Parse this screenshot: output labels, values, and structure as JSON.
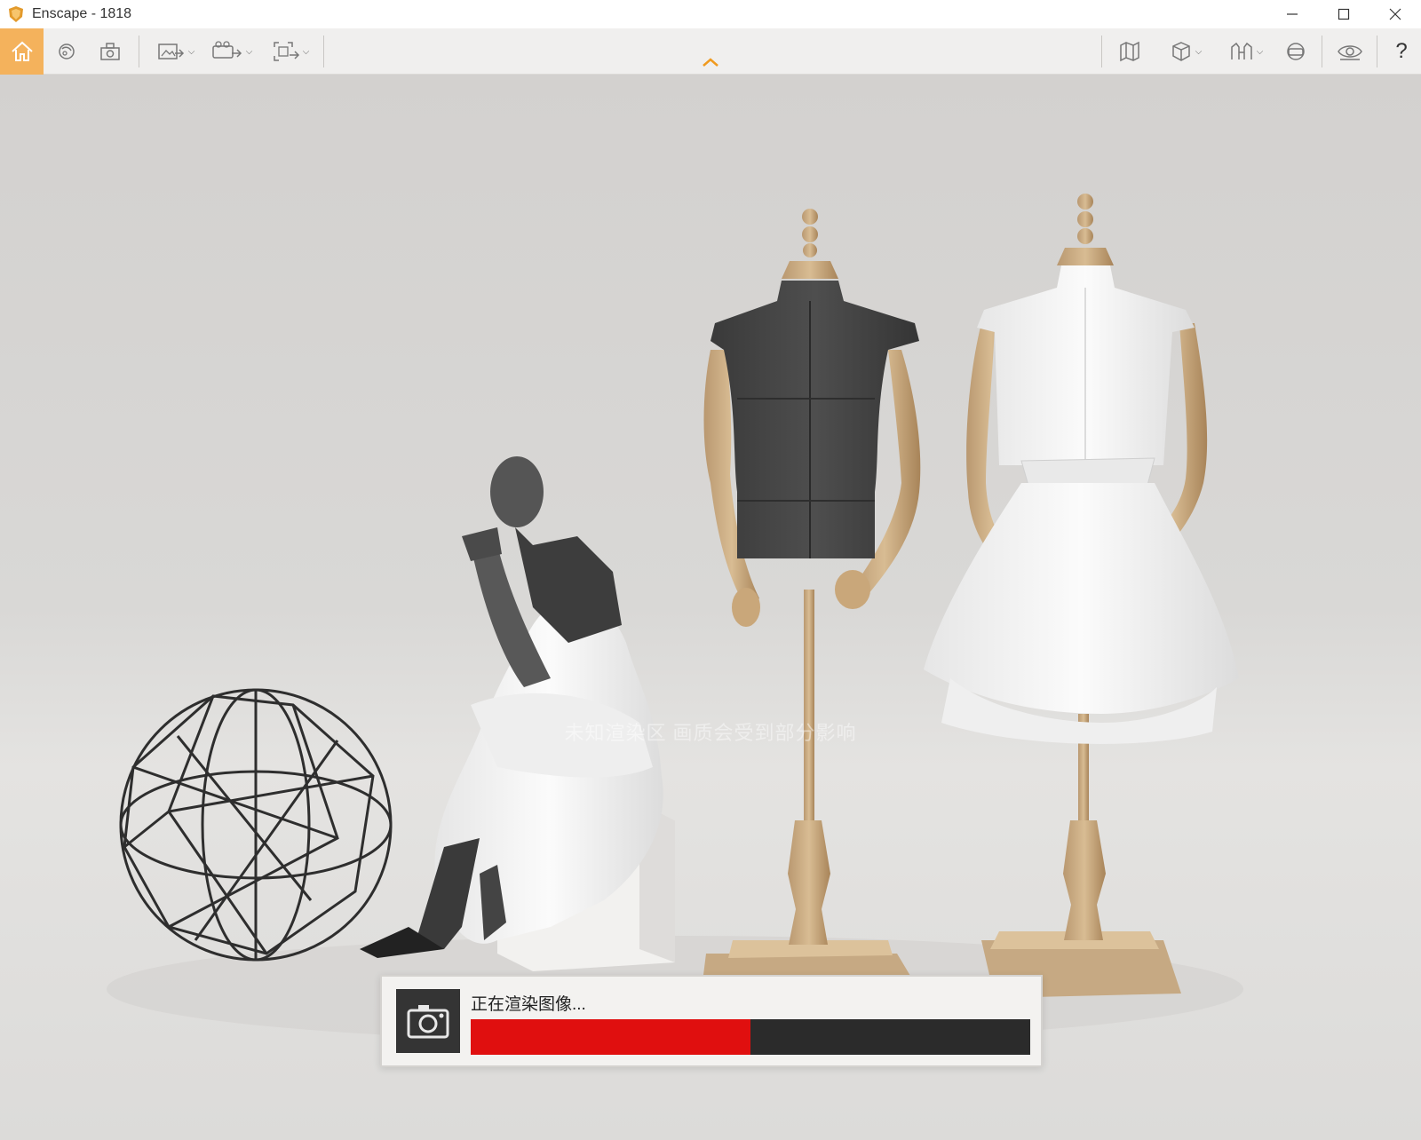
{
  "window": {
    "title": "Enscape - 1818"
  },
  "toolbar": {
    "left_icons": [
      "home-icon",
      "orbit-icon",
      "screenshot-icon",
      "export-image-icon",
      "export-video-icon",
      "capture-area-icon"
    ],
    "right_icons": [
      "map-icon",
      "cube-view-icon",
      "views-icon",
      "vr-headset-icon",
      "eye-visibility-icon",
      "help-icon"
    ],
    "help_label": "?",
    "accent_color": "#f4b25c"
  },
  "scene": {
    "watermark_text": "未知渲染区  画质会受到部分影响"
  },
  "render_dialog": {
    "status_text": "正在渲染图像...",
    "progress": 0.5,
    "fill_color": "#e00f0f"
  }
}
